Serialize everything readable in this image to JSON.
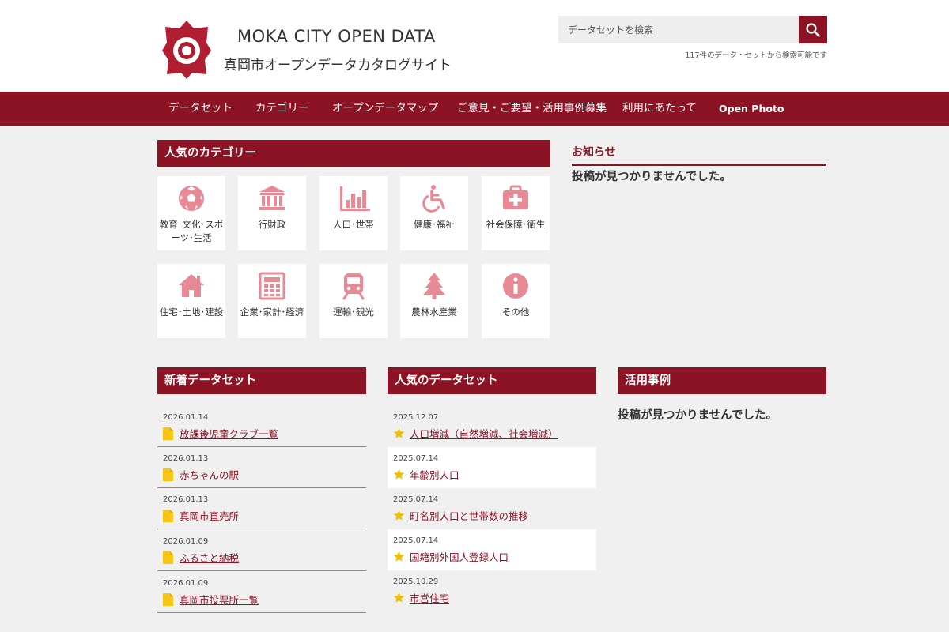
{
  "header": {
    "title": "MOKA CITY OPEN DATA",
    "subtitle": "真岡市オープンデータカタログサイト",
    "search_placeholder": "データセットを検索",
    "search_note": "117件のデータ・セットから検索可能です"
  },
  "nav": [
    {
      "label": "データセット"
    },
    {
      "label": "カテゴリー"
    },
    {
      "label": "オープンデータマップ"
    },
    {
      "label": "ご意見・ご要望・活用事例募集"
    },
    {
      "label": "利用にあたって"
    },
    {
      "label": "Open Photo"
    }
  ],
  "categories": {
    "heading": "人気のカテゴリー",
    "items": [
      {
        "label": "教育･文化･スポーツ･生活",
        "icon": "soccer-ball-icon"
      },
      {
        "label": "行財政",
        "icon": "government-building-icon"
      },
      {
        "label": "人口･世帯",
        "icon": "bar-chart-icon"
      },
      {
        "label": "健康･福祉",
        "icon": "wheelchair-icon"
      },
      {
        "label": "社会保障･衛生",
        "icon": "medical-kit-icon"
      },
      {
        "label": "住宅･土地･建設",
        "icon": "house-icon"
      },
      {
        "label": "企業･家計･経済",
        "icon": "calculator-icon"
      },
      {
        "label": "運輸･観光",
        "icon": "train-icon"
      },
      {
        "label": "農林水産業",
        "icon": "tree-icon"
      },
      {
        "label": "その他",
        "icon": "info-icon"
      }
    ]
  },
  "notice": {
    "heading": "お知らせ",
    "empty": "投稿が見つかりませんでした。"
  },
  "new_datasets": {
    "heading": "新着データセット",
    "items": [
      {
        "date": "2026.01.14",
        "title": "放課後児童クラブ一覧"
      },
      {
        "date": "2026.01.13",
        "title": "赤ちゃんの駅"
      },
      {
        "date": "2026.01.13",
        "title": "真岡市直売所"
      },
      {
        "date": "2026.01.09",
        "title": "ふるさと納税"
      },
      {
        "date": "2026.01.09",
        "title": "真岡市投票所一覧"
      }
    ]
  },
  "popular_datasets": {
    "heading": "人気のデータセット",
    "items": [
      {
        "date": "2025.12.07",
        "title": "人口増減（自然増減、社会増減）"
      },
      {
        "date": "2025.07.14",
        "title": "年齢別人口"
      },
      {
        "date": "2025.07.14",
        "title": "町名別人口と世帯数の推移"
      },
      {
        "date": "2025.07.14",
        "title": "国籍別外国人登録人口"
      },
      {
        "date": "2025.10.29",
        "title": "市営住宅"
      }
    ]
  },
  "cases": {
    "heading": "活用事例",
    "empty": "投稿が見つかりませんでした。"
  },
  "colors": {
    "brand": "#8b1324",
    "icon_pink": "#e88a96",
    "star_gold": "#f0c000",
    "file_yellow": "#f5c518"
  }
}
